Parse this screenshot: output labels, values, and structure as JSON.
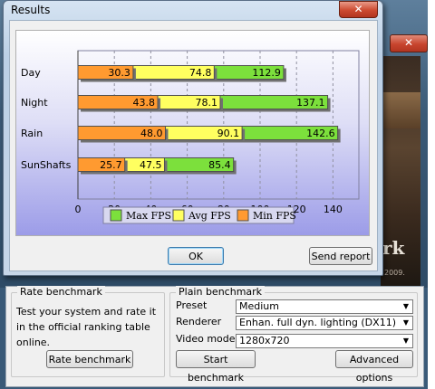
{
  "results_dialog": {
    "title": "Results",
    "close_glyph": "✕",
    "ok_label": "OK",
    "send_report_label": "Send report"
  },
  "main_window": {
    "close_glyph": "✕",
    "splash_text": "rk",
    "splash_copyright": "2009.",
    "rate_group": {
      "title": "Rate benchmark",
      "description": "Test your system and rate it in the official ranking table online.",
      "button_label": "Rate benchmark"
    },
    "plain_group": {
      "title": "Plain benchmark",
      "preset_label": "Preset",
      "preset_value": "Medium",
      "renderer_label": "Renderer",
      "renderer_value": "Enhan. full dyn. lighting (DX11)",
      "video_mode_label": "Video mode",
      "video_mode_value": "1280x720",
      "start_button_label": "Start benchmark",
      "advanced_button_label": "Advanced options"
    }
  },
  "chart_data": {
    "type": "bar",
    "orientation": "horizontal",
    "categories": [
      "Day",
      "Night",
      "Rain",
      "SunShafts"
    ],
    "series": [
      {
        "name": "Max FPS",
        "values": [
          112.9,
          137.1,
          142.6,
          85.4
        ],
        "color": "#7ce03c"
      },
      {
        "name": "Avg FPS",
        "values": [
          74.8,
          78.1,
          90.1,
          47.5
        ],
        "color": "#ffff60"
      },
      {
        "name": "Min FPS",
        "values": [
          30.3,
          43.8,
          48.0,
          25.7
        ],
        "color": "#ff9a30"
      }
    ],
    "x_ticks": [
      "0",
      "20",
      "40",
      "60",
      "80",
      "100",
      "120",
      "140"
    ],
    "xlim": [
      0,
      150
    ],
    "grid": true,
    "legend_position": "bottom"
  }
}
